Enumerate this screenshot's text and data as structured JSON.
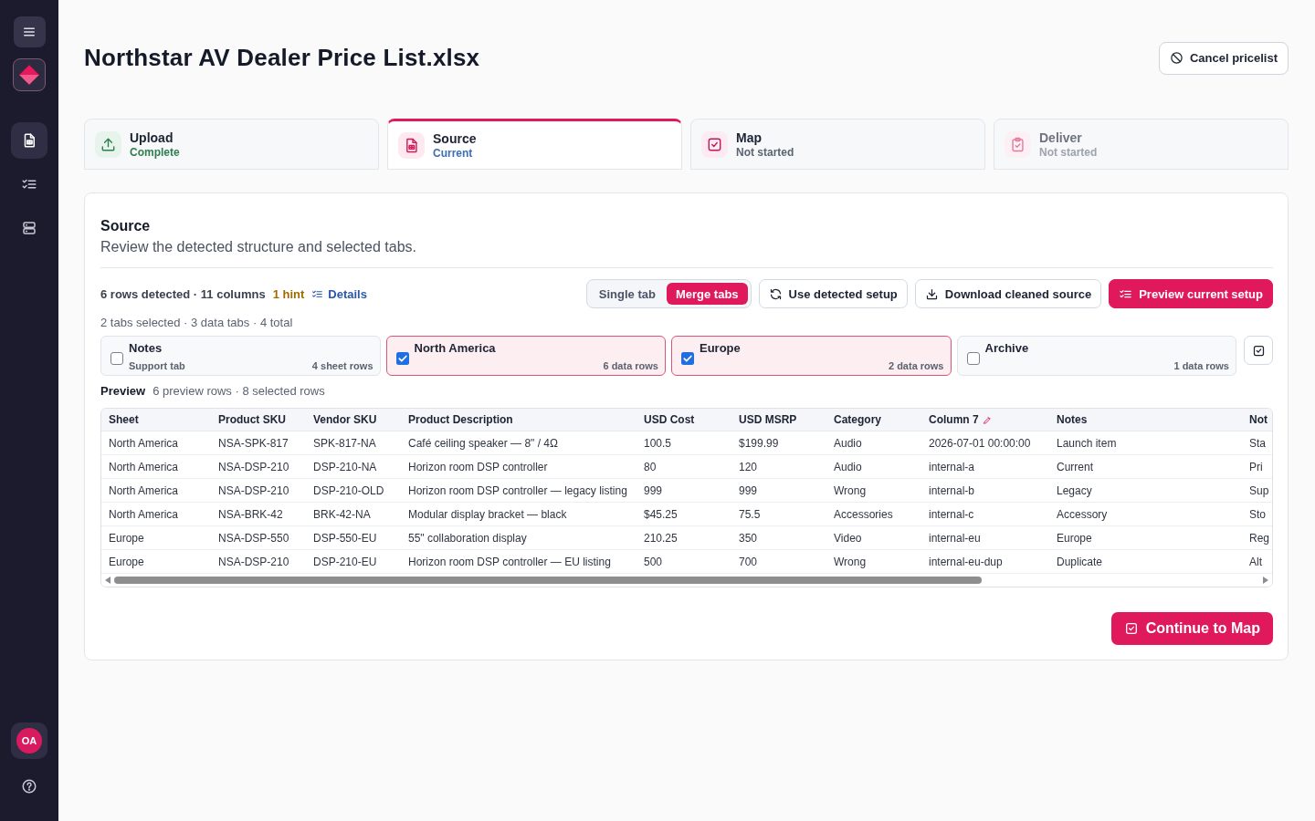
{
  "sidebar": {
    "nav": [
      {
        "selected": true
      },
      {
        "selected": false
      },
      {
        "selected": false
      }
    ],
    "avatar": "OA"
  },
  "header": {
    "title": "Northstar AV Dealer Price List.xlsx",
    "cancel_button": "Cancel pricelist"
  },
  "steps": [
    {
      "title": "Upload",
      "status": "Complete",
      "kind": "complete",
      "selected": false
    },
    {
      "title": "Source",
      "status": "Current",
      "kind": "current",
      "selected": true
    },
    {
      "title": "Map",
      "status": "Not started",
      "kind": "pending",
      "selected": false
    },
    {
      "title": "Deliver",
      "status": "Not started",
      "kind": "locked",
      "selected": false
    }
  ],
  "panel": {
    "title": "Source",
    "subtitle": "Review the detected structure and selected tabs.",
    "summary": "6 rows detected · 11 columns",
    "hint": "1 hint",
    "details_link": "Details",
    "mode_toggle": [
      {
        "label": "Single tab",
        "selected": false
      },
      {
        "label": "Merge tabs",
        "selected": true
      }
    ],
    "actions": [
      {
        "label": "Use detected setup",
        "kind": "secondary"
      },
      {
        "label": "Download cleaned source",
        "kind": "secondary"
      },
      {
        "label": "Preview current setup",
        "kind": "primary"
      }
    ],
    "tabs_summary": "2 tabs selected · 3 data tabs · 4 total",
    "sheet_tabs": [
      {
        "name": "Notes",
        "note": "Support tab",
        "rows": "4 sheet rows",
        "checked": false
      },
      {
        "name": "North America",
        "rows": "6 data rows",
        "checked": true
      },
      {
        "name": "Europe",
        "rows": "2 data rows",
        "checked": true
      },
      {
        "name": "Archive",
        "rows": "1 data rows",
        "checked": false
      }
    ],
    "preview_label": "Preview",
    "preview_summary": "6 preview rows · 8 selected rows",
    "table": {
      "columns": [
        {
          "label": "Sheet",
          "editable": false
        },
        {
          "label": "Product SKU",
          "editable": false
        },
        {
          "label": "Vendor SKU",
          "editable": false
        },
        {
          "label": "Product Description",
          "editable": false
        },
        {
          "label": "USD Cost",
          "editable": false
        },
        {
          "label": "USD MSRP",
          "editable": false
        },
        {
          "label": "Category",
          "editable": false
        },
        {
          "label": "Column 7",
          "editable": true
        },
        {
          "label": "Notes",
          "editable": false
        },
        {
          "label": "Not"
        }
      ],
      "rows": [
        [
          "North America",
          "NSA-SPK-817",
          "SPK-817-NA",
          "Café ceiling speaker — 8\" / 4Ω",
          "100.5",
          "$199.99",
          "Audio",
          "2026-07-01 00:00:00",
          "Launch item",
          "Sta"
        ],
        [
          "North America",
          "NSA-DSP-210",
          "DSP-210-NA",
          "Horizon room DSP controller",
          "80",
          "120",
          "Audio",
          "internal-a",
          "Current",
          "Pri"
        ],
        [
          "North America",
          "NSA-DSP-210",
          "DSP-210-OLD",
          "Horizon room DSP controller — legacy listing",
          "999",
          "999",
          "Wrong",
          "internal-b",
          "Legacy",
          "Sup"
        ],
        [
          "North America",
          "NSA-BRK-42",
          "BRK-42-NA",
          "Modular display bracket — black",
          "$45.25",
          "75.5",
          "Accessories",
          "internal-c",
          "Accessory",
          "Sto"
        ],
        [
          "Europe",
          "NSA-DSP-550",
          "DSP-550-EU",
          "55\" collaboration display",
          "210.25",
          "350",
          "Video",
          "internal-eu",
          "Europe",
          "Reg"
        ],
        [
          "Europe",
          "NSA-DSP-210",
          "DSP-210-EU",
          "Horizon room DSP controller — EU listing",
          "500",
          "700",
          "Wrong",
          "internal-eu-dup",
          "Duplicate",
          "Alt"
        ]
      ]
    },
    "continue_button": "Continue to Map"
  }
}
